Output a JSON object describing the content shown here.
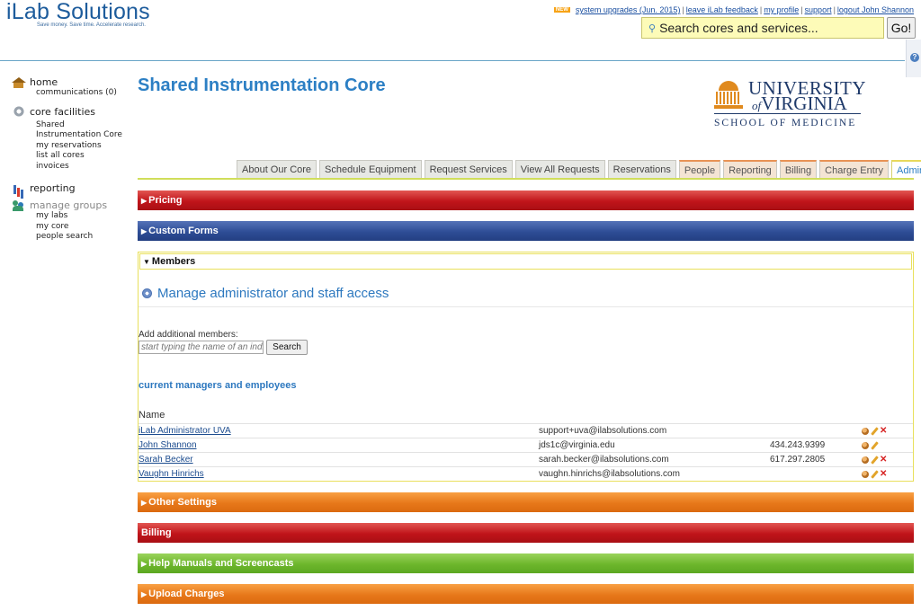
{
  "header": {
    "logo_title": "iLab Solutions",
    "logo_tagline": "Save money. Save time. Accelerate research.",
    "new_badge": "NEW",
    "links": [
      "system upgrades (Jun. 2015)",
      "leave iLab feedback",
      "my profile",
      "support",
      "logout John Shannon"
    ],
    "search_placeholder": "Search cores and services...",
    "go_label": "Go!"
  },
  "sidebar": {
    "home": {
      "label": "home",
      "items": [
        "communications (0)"
      ]
    },
    "core_facilities": {
      "label": "core facilities",
      "items": [
        "Shared Instrumentation Core",
        "my reservations",
        "list all cores",
        "invoices"
      ]
    },
    "reporting": {
      "label": "reporting"
    },
    "manage_groups": {
      "label": "manage groups",
      "items": [
        "my labs",
        "my core",
        "people search"
      ]
    }
  },
  "main": {
    "title": "Shared Instrumentation Core",
    "logo": {
      "line1": "UNIVERSITY",
      "of": "of",
      "line2": "VIRGINIA",
      "school": "SCHOOL OF MEDICINE"
    },
    "tabs": [
      {
        "label": "About Our Core",
        "style": "gray"
      },
      {
        "label": "Schedule Equipment",
        "style": "gray"
      },
      {
        "label": "Request Services",
        "style": "gray"
      },
      {
        "label": "View All Requests",
        "style": "gray"
      },
      {
        "label": "Reservations",
        "style": "gray"
      },
      {
        "label": "People",
        "style": "orange"
      },
      {
        "label": "Reporting",
        "style": "orange"
      },
      {
        "label": "Billing",
        "style": "orange"
      },
      {
        "label": "Charge Entry",
        "style": "orange"
      },
      {
        "label": "Administration",
        "style": "active"
      }
    ],
    "sections": {
      "pricing": "Pricing",
      "custom_forms": "Custom Forms",
      "members": "Members",
      "other_settings": "Other Settings",
      "billing": "Billing",
      "help": "Help Manuals and Screencasts",
      "upload": "Upload Charges"
    },
    "members": {
      "manage_title": "Manage administrator and staff access",
      "add_label": "Add additional members:",
      "add_placeholder": "start typing the name of an individual",
      "search_label": "Search",
      "subtitle": "current managers and employees",
      "name_header": "Name",
      "rows": [
        {
          "name": "iLab Administrator UVA",
          "email": "support+uva@ilabsolutions.com",
          "phone": "",
          "removable": true
        },
        {
          "name": "John Shannon",
          "email": "jds1c@virginia.edu",
          "phone": "434.243.9399",
          "removable": false
        },
        {
          "name": "Sarah Becker",
          "email": "sarah.becker@ilabsolutions.com",
          "phone": "617.297.2805",
          "removable": true
        },
        {
          "name": "Vaughn Hinrichs",
          "email": "vaughn.hinrichs@ilabsolutions.com",
          "phone": "",
          "removable": true
        }
      ]
    }
  }
}
